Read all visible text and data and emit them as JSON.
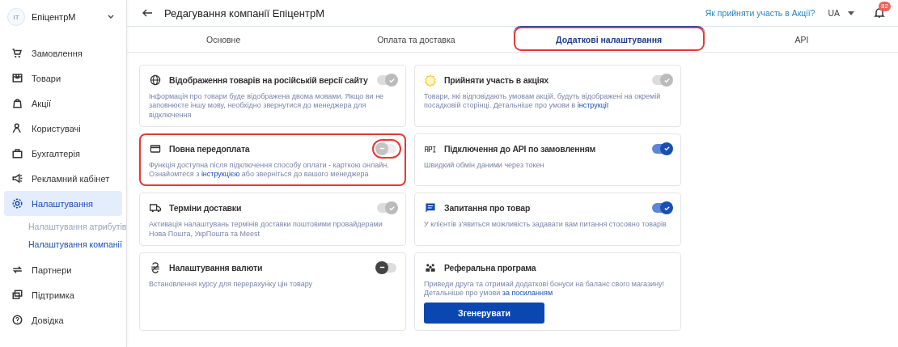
{
  "sidebar": {
    "account": {
      "avatar": "IT",
      "name": "ЕпіцентрМ"
    },
    "items": [
      {
        "label": "Замовлення",
        "selected": false
      },
      {
        "label": "Товари",
        "selected": false
      },
      {
        "label": "Акції",
        "selected": false
      },
      {
        "label": "Користувачі",
        "selected": false
      },
      {
        "label": "Бухгалтерія",
        "selected": false
      },
      {
        "label": "Рекламний кабінет",
        "selected": false
      },
      {
        "label": "Налаштування",
        "selected": true,
        "children": [
          {
            "label": "Налаштування атрибутів",
            "selected": false
          },
          {
            "label": "Налаштування компанії",
            "selected": true
          }
        ]
      },
      {
        "label": "Партнери",
        "selected": false
      },
      {
        "label": "Підтримка",
        "selected": false
      },
      {
        "label": "Довідка",
        "selected": false
      }
    ]
  },
  "header": {
    "title": "Редагування компанії ЕпіцентрМ",
    "help_link": "Як прийняти участь в Акції?",
    "language": "UA",
    "notifications": "82"
  },
  "tabs": [
    {
      "label": "Основне",
      "selected": false,
      "highlighted": false
    },
    {
      "label": "Оплата та доставка",
      "selected": false,
      "highlighted": false
    },
    {
      "label": "Додаткові налаштування",
      "selected": true,
      "highlighted": true
    },
    {
      "label": "API",
      "selected": false,
      "highlighted": false
    }
  ],
  "cards": [
    {
      "kind": "toggle",
      "title": "Відображення товарів на російській версії сайту",
      "description": {
        "text": "Інформація про товари буде відображена двома мовами. Якщо ви не заповнюєте іншу мову, необхідно звернутися до менеджера для відключення"
      },
      "toggle": {
        "checked": true,
        "disabled": true
      },
      "highlighted": false
    },
    {
      "kind": "toggle",
      "title": "Прийняти участь в акціях",
      "description": {
        "text": "Товари, які відповідають умовам акцій, будуть відображені на окремій посадковій сторінці. Детальніше про умови в",
        "link": "інструкції"
      },
      "toggle": {
        "checked": true,
        "disabled": true
      },
      "highlighted": false
    },
    {
      "kind": "toggle",
      "title": "Повна передоплата",
      "description": {
        "text": "Функція доступна після підключення способу оплати - карткою онлайн. Ознайомтеся з",
        "link": "інструкцією",
        "after": "або зверніться до вашого менеджера"
      },
      "toggle": {
        "checked": false,
        "disabled": true
      },
      "highlighted": true
    },
    {
      "kind": "toggle",
      "title": "Підключення до API по замовленням",
      "description": {
        "text": "Швидкий обмін даними через токен"
      },
      "toggle": {
        "checked": true,
        "disabled": false
      },
      "highlighted": false
    },
    {
      "kind": "toggle",
      "title": "Терміни доставки",
      "description": {
        "text": "Активація налаштувань термінів доставки поштовими провайдерами Нова Пошта, УкрПошта та Meest"
      },
      "toggle": {
        "checked": true,
        "disabled": true
      },
      "highlighted": false
    },
    {
      "kind": "toggle",
      "title": "Запитання про товар",
      "description": {
        "text": "У клієнтів з'явиться можливість задавати вам питання стосовно товарів"
      },
      "toggle": {
        "checked": true,
        "disabled": false
      },
      "highlighted": false
    },
    {
      "kind": "toggle",
      "title": "Налаштування валюти",
      "description": {
        "text": "Встановлення курсу для перерахунку цін товару"
      },
      "toggle": {
        "checked": false,
        "disabled": false
      },
      "highlighted": false
    },
    {
      "kind": "button",
      "title": "Реферальна програма",
      "description": {
        "text": "Приведи друга та отримай додаткові бонуси на баланс свого магазину! Детальніше про умови",
        "link": "за посиланням"
      },
      "button": "Згенерувати",
      "highlighted": false
    }
  ]
}
